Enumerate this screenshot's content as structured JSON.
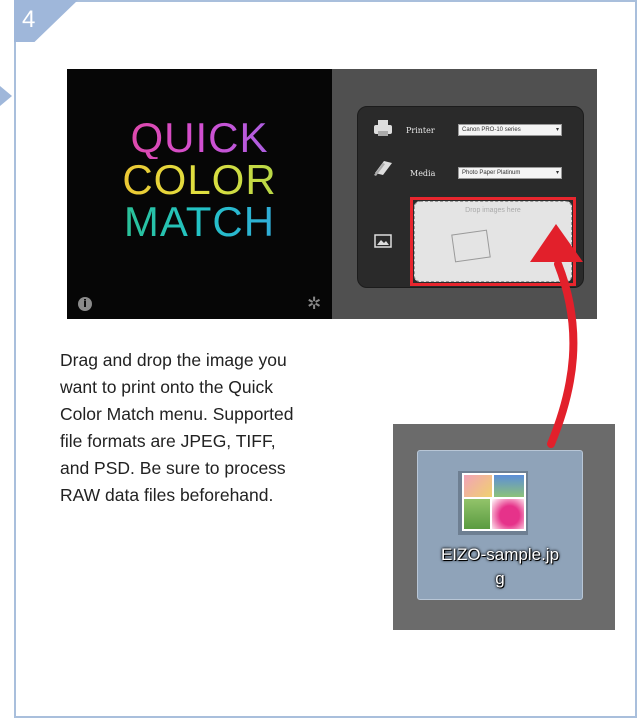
{
  "step": {
    "number": "4"
  },
  "app": {
    "logo_lines": [
      "QUICK",
      "COLOR",
      "MATCH"
    ],
    "printer_label": "Printer",
    "printer_value": "Canon PRO-10 series",
    "media_label": "Media",
    "media_value": "Photo Paper Platinum",
    "drop_text": "Drop images here",
    "info_icon": "i",
    "gear_icon": "✲",
    "printer_icon": "printer-icon",
    "media_icon": "paper-stack-icon",
    "image_icon": "picture-icon"
  },
  "description": {
    "lines": [
      "Drag and drop the image you",
      "want to print onto the Quick",
      "Color Match menu. Supported",
      "file formats are JPEG, TIFF,",
      "and PSD. Be sure to process",
      "RAW data files beforehand."
    ]
  },
  "desktop_file": {
    "name_lines": [
      "EIZO-sample.jp",
      "g"
    ]
  },
  "colors": {
    "frame": "#a9bfdc",
    "highlight": "#e8262e",
    "arrow": "#e2202b"
  }
}
